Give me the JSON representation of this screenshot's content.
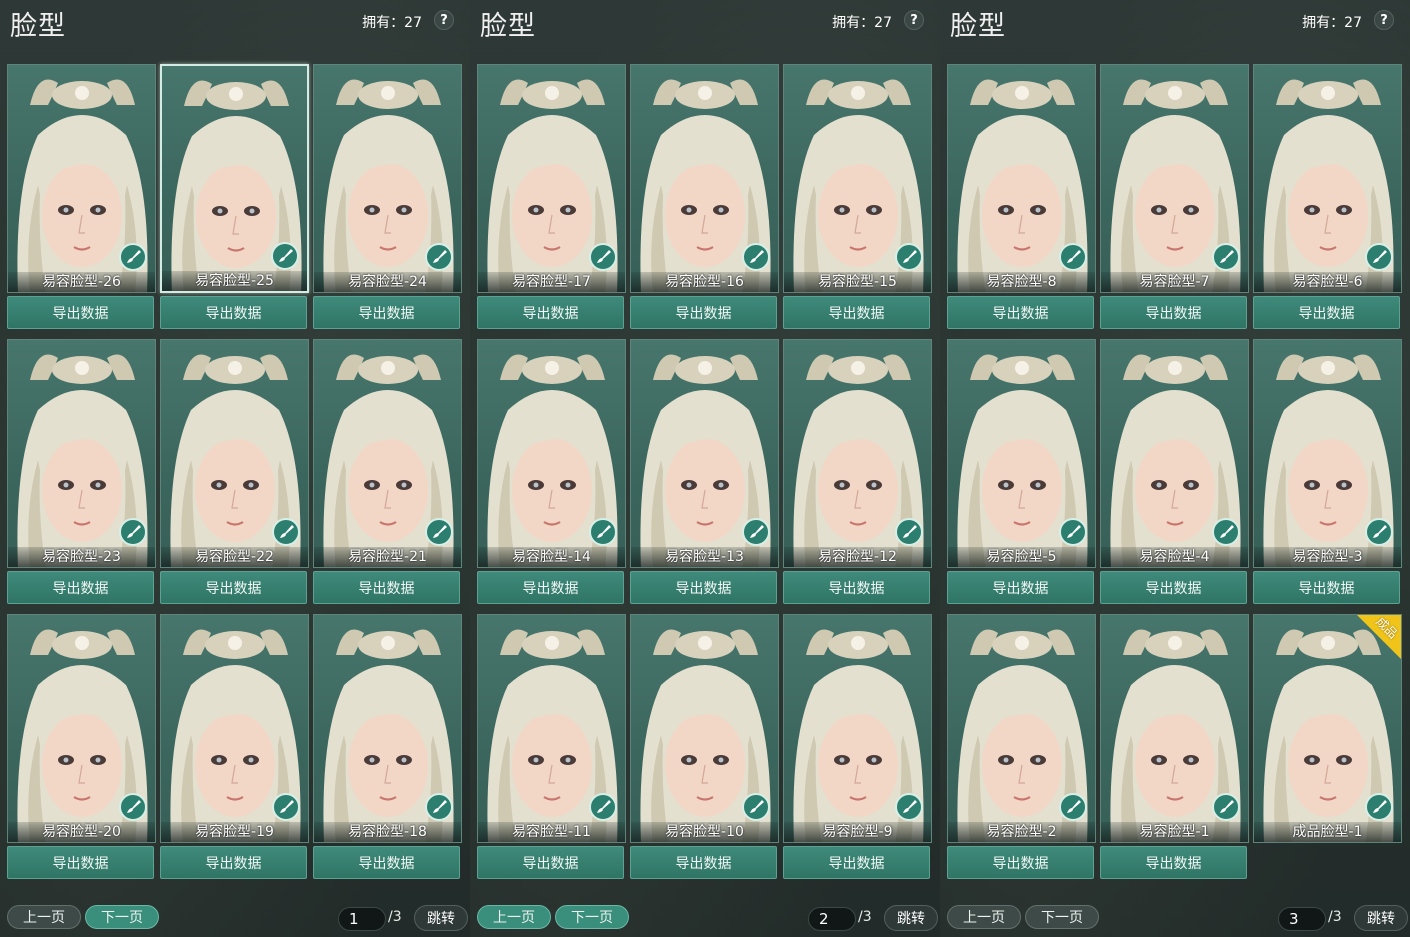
{
  "panels": [
    {
      "title": "脸型",
      "owned": "拥有：27",
      "help": "?",
      "cards": [
        {
          "label": "易容脸型-26"
        },
        {
          "label": "易容脸型-25",
          "selected": true
        },
        {
          "label": "易容脸型-24"
        },
        {
          "label": "易容脸型-23"
        },
        {
          "label": "易容脸型-22"
        },
        {
          "label": "易容脸型-21"
        },
        {
          "label": "易容脸型-20"
        },
        {
          "label": "易容脸型-19"
        },
        {
          "label": "易容脸型-18"
        }
      ],
      "export_label": "导出数据",
      "prev": "上一页",
      "next": "下一页",
      "page": "1",
      "total": "/3",
      "jump": "跳转"
    },
    {
      "title": "脸型",
      "owned": "拥有：27",
      "help": "?",
      "cards": [
        {
          "label": "易容脸型-17"
        },
        {
          "label": "易容脸型-16"
        },
        {
          "label": "易容脸型-15"
        },
        {
          "label": "易容脸型-14"
        },
        {
          "label": "易容脸型-13"
        },
        {
          "label": "易容脸型-12"
        },
        {
          "label": "易容脸型-11"
        },
        {
          "label": "易容脸型-10"
        },
        {
          "label": "易容脸型-9"
        }
      ],
      "export_label": "导出数据",
      "prev": "上一页",
      "next": "下一页",
      "page": "2",
      "total": "/3",
      "jump": "跳转"
    },
    {
      "title": "脸型",
      "owned": "拥有：27",
      "help": "?",
      "cards": [
        {
          "label": "易容脸型-8"
        },
        {
          "label": "易容脸型-7"
        },
        {
          "label": "易容脸型-6"
        },
        {
          "label": "易容脸型-5"
        },
        {
          "label": "易容脸型-4"
        },
        {
          "label": "易容脸型-3"
        },
        {
          "label": "易容脸型-2"
        },
        {
          "label": "易容脸型-1"
        },
        {
          "label": "成品脸型-1",
          "badge": "成品",
          "no_export": true
        }
      ],
      "export_label": "导出数据",
      "prev": "上一页",
      "next": "下一页",
      "page": "3",
      "total": "/3",
      "jump": "跳转"
    }
  ],
  "colors": {
    "accent": "#2f7565",
    "card_bg": "#3e6a62",
    "badge": "#f0c419"
  },
  "icons": {
    "edit": "brush-icon",
    "help": "question-icon"
  }
}
